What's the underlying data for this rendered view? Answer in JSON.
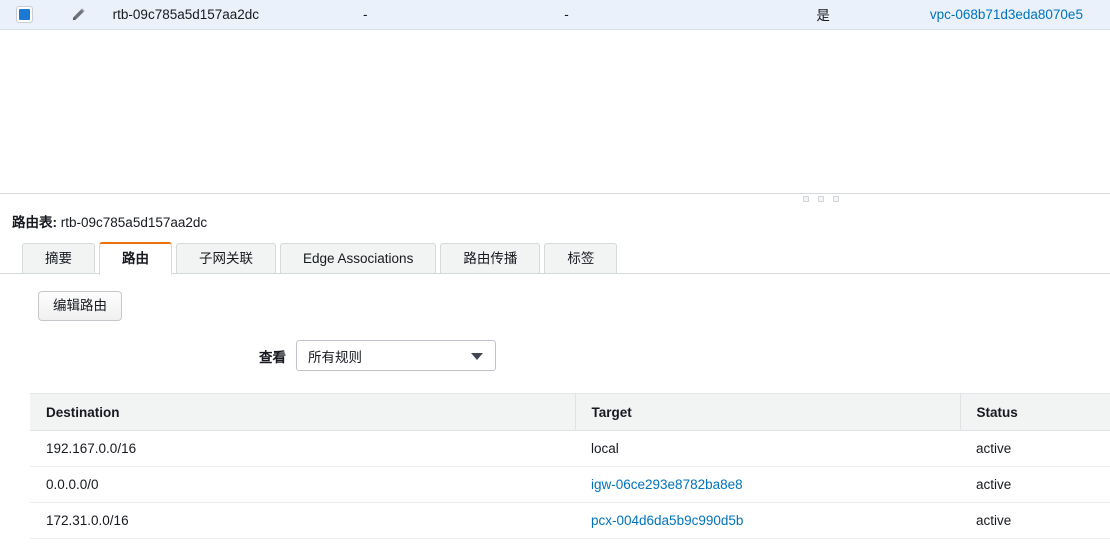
{
  "resource_row": {
    "checkbox_state": "checked",
    "edit_icon": "pencil-icon",
    "route_table_id": "rtb-09c785a5d157aa2dc",
    "col3": "-",
    "col4": "-",
    "main": "是",
    "vpc_id": "vpc-068b71d3eda8070e5",
    "selected_bg": "#eaf1fb",
    "link_color": "#0073bb"
  },
  "detail": {
    "title_label": "路由表:",
    "title_value": "rtb-09c785a5d157aa2dc",
    "accent_color": "#ec7211",
    "tabs": [
      {
        "label": "摘要",
        "active": false
      },
      {
        "label": "路由",
        "active": true
      },
      {
        "label": "子网关联",
        "active": false
      },
      {
        "label": "Edge Associations",
        "active": false
      },
      {
        "label": "路由传播",
        "active": false
      },
      {
        "label": "标签",
        "active": false
      }
    ]
  },
  "routes_tab": {
    "edit_button": "编辑路由",
    "filter_label": "查看",
    "filter_value": "所有规则",
    "filter_options": [
      "所有规则"
    ],
    "table": {
      "headers": [
        "Destination",
        "Target",
        "Status"
      ],
      "rows": [
        {
          "destination": "192.167.0.0/16",
          "target": "local",
          "target_is_link": false,
          "status": "active"
        },
        {
          "destination": "0.0.0.0/0",
          "target": "igw-06ce293e8782ba8e8",
          "target_is_link": true,
          "status": "active"
        },
        {
          "destination": "172.31.0.0/16",
          "target": "pcx-004d6da5b9c990d5b",
          "target_is_link": true,
          "status": "active"
        }
      ],
      "status_color": "#1d8102"
    }
  }
}
